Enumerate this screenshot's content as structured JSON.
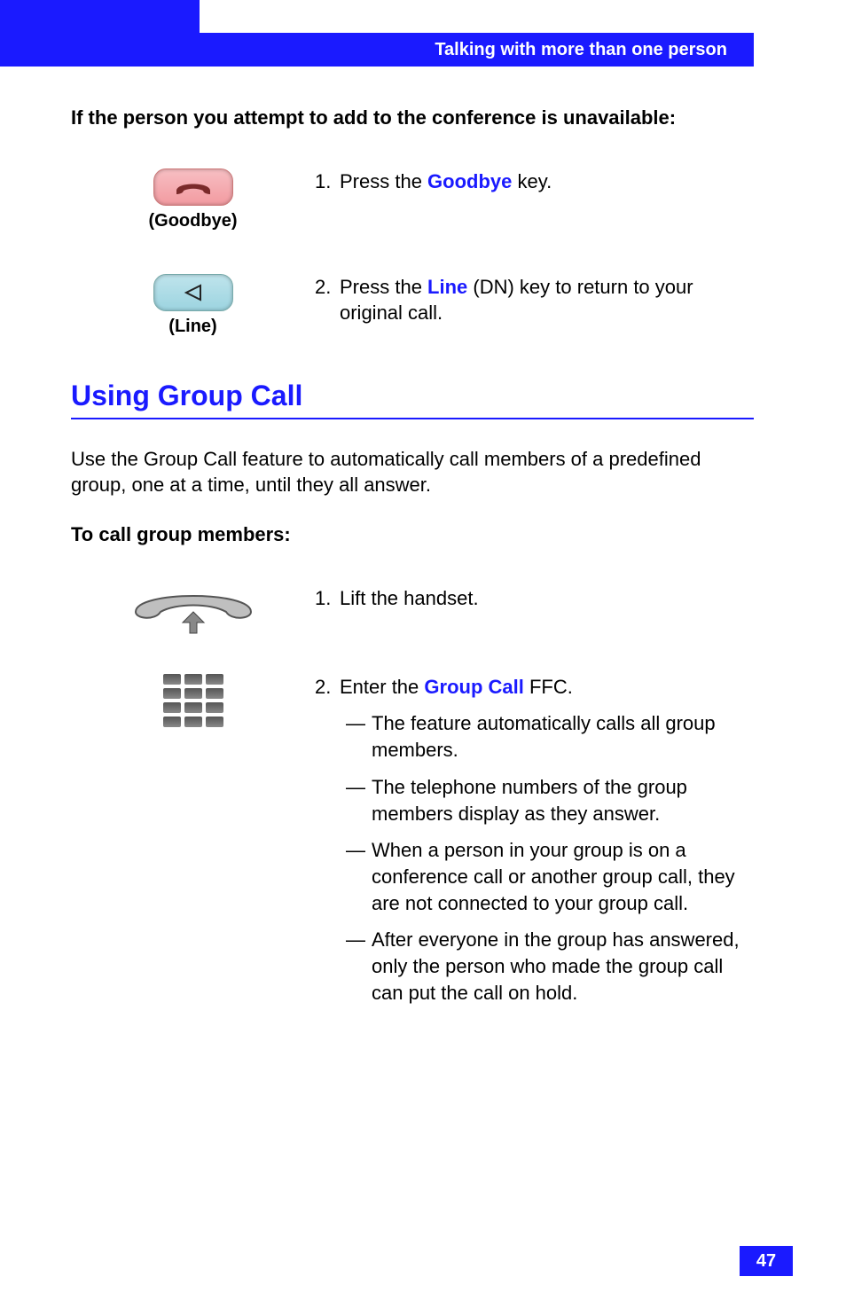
{
  "header": {
    "title": "Talking with more than one person"
  },
  "intro": {
    "subhead": "If the person you attempt to add to the conference is unavailable:"
  },
  "steps_a": {
    "step1": {
      "num": "1.",
      "pre": "Press the ",
      "keyword": "Goodbye",
      "post": " key.",
      "icon_label": "(Goodbye)"
    },
    "step2": {
      "num": "2.",
      "pre": "Press the ",
      "keyword": "Line",
      "post": " (DN) key to return to your original call.",
      "icon_label": "(Line)"
    }
  },
  "section": {
    "title": "Using Group Call",
    "para": "Use the Group Call feature to automatically call members of a predefined group, one at a time, until they all answer.",
    "subhead": "To call group members:"
  },
  "steps_b": {
    "step1": {
      "num": "1.",
      "text": "Lift the handset."
    },
    "step2": {
      "num": "2.",
      "pre": "Enter the ",
      "keyword": "Group Call",
      "post": " FFC.",
      "bullets": {
        "b1": "The feature automatically calls all group members.",
        "b2": "The telephone numbers of the group members display as they answer.",
        "b3": "When a person in your group is on a conference call or another group call, they are not connected to your group call.",
        "b4": "After everyone in the group has answered, only the person who made the group call can put the call on hold."
      }
    }
  },
  "dash": "—",
  "page_number": "47"
}
